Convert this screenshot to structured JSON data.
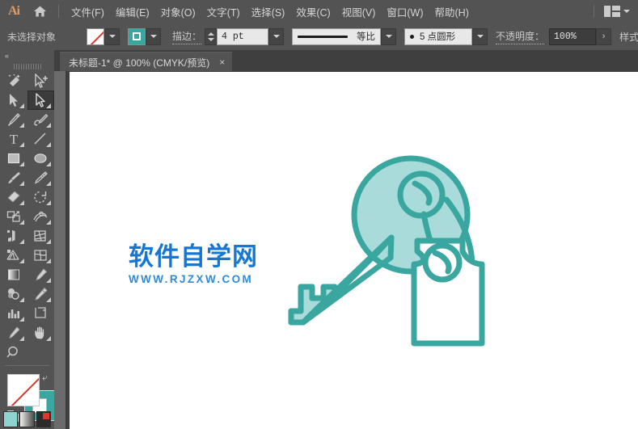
{
  "app": {
    "name": "Ai",
    "logo_color": "#e09a63"
  },
  "menubar": {
    "home_icon": "home-icon",
    "items": [
      {
        "label": "文件(F)",
        "name": "menu-file"
      },
      {
        "label": "编辑(E)",
        "name": "menu-edit"
      },
      {
        "label": "对象(O)",
        "name": "menu-object"
      },
      {
        "label": "文字(T)",
        "name": "menu-type"
      },
      {
        "label": "选择(S)",
        "name": "menu-select"
      },
      {
        "label": "效果(C)",
        "name": "menu-effect"
      },
      {
        "label": "视图(V)",
        "name": "menu-view"
      },
      {
        "label": "窗口(W)",
        "name": "menu-window"
      },
      {
        "label": "帮助(H)",
        "name": "menu-help"
      }
    ],
    "arrange_icon": "arrange-documents-icon",
    "arrange_chevron": "chevron-down-icon"
  },
  "controlbar": {
    "selection_status": "未选择对象",
    "fill_swatch": "none-swatch",
    "fill_dropdown": "chevron-down-icon",
    "stroke_swatch_color": "#3aa6a0",
    "stroke_dropdown": "chevron-down-icon",
    "stroke_label": "描边：",
    "stroke_weight": "4 pt",
    "stroke_weight_dropdown": "chevron-down-icon",
    "profile_label": "等比",
    "profile_dropdown": "chevron-down-icon",
    "brush_label": "5 点圆形",
    "brush_dropdown": "chevron-down-icon",
    "opacity_label": "不透明度：",
    "opacity_value": "100%",
    "opacity_arrow": "›",
    "style_label": "样式：",
    "style_dropdown": "chevron-down-icon"
  },
  "tabbar": {
    "tab_title": "未标题-1* @ 100% (CMYK/预览)",
    "close_glyph": "×"
  },
  "toolpanel": {
    "collapse_glyph": "«",
    "tools": [
      {
        "name": "magic-wand-tool",
        "has_corner": false
      },
      {
        "name": "add-anchor-point-tool",
        "has_corner": false
      },
      {
        "name": "selection-tool",
        "has_corner": true
      },
      {
        "name": "direct-selection-tool",
        "has_corner": true,
        "active": true
      },
      {
        "name": "pen-tool",
        "has_corner": true
      },
      {
        "name": "curvature-tool",
        "has_corner": true
      },
      {
        "name": "type-tool",
        "has_corner": true
      },
      {
        "name": "line-segment-tool",
        "has_corner": true
      },
      {
        "name": "rectangle-tool",
        "has_corner": true
      },
      {
        "name": "ellipse-tool",
        "has_corner": true
      },
      {
        "name": "paintbrush-tool",
        "has_corner": true
      },
      {
        "name": "blob-brush-tool",
        "has_corner": true
      },
      {
        "name": "eraser-tool",
        "has_corner": true
      },
      {
        "name": "rotate-tool",
        "has_corner": true
      },
      {
        "name": "scale-tool",
        "has_corner": true
      },
      {
        "name": "width-tool",
        "has_corner": true
      },
      {
        "name": "free-transform-tool",
        "has_corner": true
      },
      {
        "name": "shape-builder-tool",
        "has_corner": true
      },
      {
        "name": "perspective-grid-tool",
        "has_corner": true
      },
      {
        "name": "mesh-tool",
        "has_corner": true
      },
      {
        "name": "gradient-tool",
        "has_corner": false
      },
      {
        "name": "eyedropper-tool",
        "has_corner": true
      },
      {
        "name": "blend-tool",
        "has_corner": true
      },
      {
        "name": "measure-tool",
        "has_corner": true
      },
      {
        "name": "column-graph-tool",
        "has_corner": true
      },
      {
        "name": "artboard-tool",
        "has_corner": false
      },
      {
        "name": "slice-tool",
        "has_corner": true
      },
      {
        "name": "hand-tool",
        "has_corner": true
      },
      {
        "name": "zoom-tool",
        "has_corner": false
      }
    ],
    "fill_indicator": "fill-swatch-none",
    "stroke_indicator": "stroke-swatch",
    "stroke_indicator_color": "#3aa6a0",
    "swap_icon": "swap-fill-stroke-icon",
    "default_icon": "default-fill-stroke-icon",
    "mode_buttons": [
      "color-mode-button",
      "gradient-mode-button",
      "none-mode-button"
    ]
  },
  "canvas": {
    "watermark_cn": "软件自学网",
    "watermark_en": "WWW.RJZXW.COM",
    "watermark_color_cn": "#1677d2",
    "watermark_color_en": "#2f8ad8",
    "artwork_name": "key-with-tag-illustration",
    "artwork_fill": "#a8dbd9",
    "artwork_stroke": "#3aa6a0",
    "artwork_stroke_width": 7
  }
}
